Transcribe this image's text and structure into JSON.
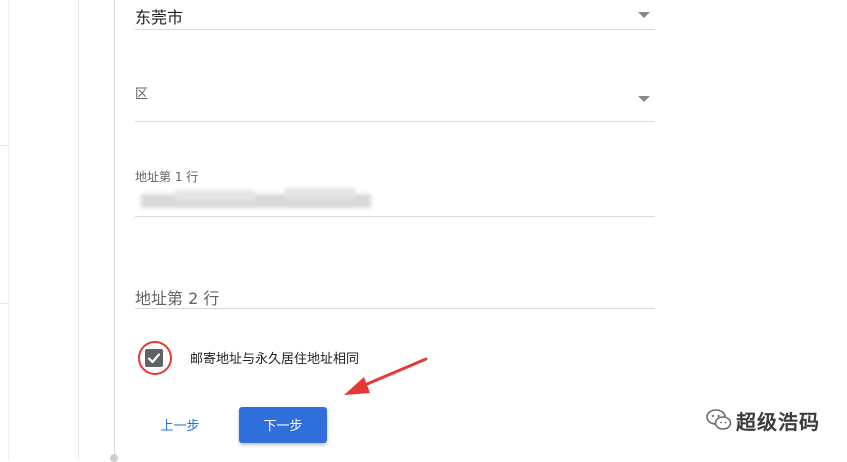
{
  "form": {
    "city": {
      "value": "东莞市",
      "icon": "dropdown-caret-icon"
    },
    "district": {
      "label": "区",
      "icon": "dropdown-caret-icon"
    },
    "address_line1": {
      "label": "地址第 1 行"
    },
    "address_line2": {
      "placeholder": "地址第 2 行"
    },
    "mailing_same": {
      "label": "邮寄地址与永久居住地址相同",
      "checked": true,
      "icon": "checkmark-icon"
    }
  },
  "buttons": {
    "back": "上一步",
    "next": "下一步"
  },
  "watermark": {
    "text": "超级浩码",
    "icon": "wechat-logo-icon"
  },
  "colors": {
    "primary_button": "#2f6fdc",
    "link": "#1a73e8",
    "annotation_red": "#e53935",
    "checkbox_fill": "#5f6368"
  }
}
